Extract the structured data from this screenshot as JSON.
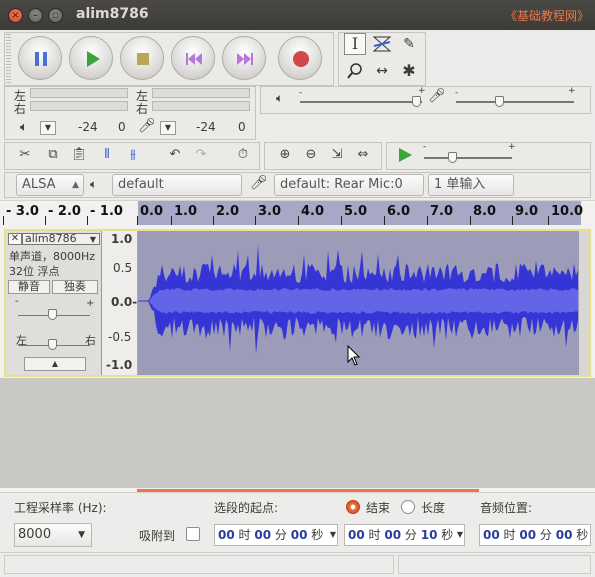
{
  "window": {
    "title": "alim8786",
    "watermark": "《基础教程网》"
  },
  "meters": {
    "left": "左",
    "right": "右",
    "play_db": "-24",
    "play_zero": "0",
    "rec_db": "-24",
    "rec_zero": "0"
  },
  "mixer": {
    "plus": "+",
    "minus": "-"
  },
  "device": {
    "host": "ALSA",
    "output": "default",
    "input": "default: Rear Mic:0",
    "channels": "1 单输入"
  },
  "ruler": {
    "ticks": [
      "- 3.0",
      "- 2.0",
      "- 1.0",
      "0.0",
      "1.0",
      "2.0",
      "3.0",
      "4.0",
      "5.0",
      "6.0",
      "7.0",
      "8.0",
      "9.0",
      "10.0"
    ]
  },
  "track": {
    "name": "alim8786",
    "info1": "单声道，8000Hz",
    "info2": "32位 浮点",
    "mute": "静音",
    "solo": "独奏",
    "gain_minus": "-",
    "gain_plus": "+",
    "pan_left": "左",
    "pan_right": "右",
    "scale": [
      "1.0",
      "0.5",
      "0.0-",
      "-0.5",
      "-1.0"
    ]
  },
  "selection": {
    "rate_label": "工程采样率 (Hz):",
    "rate_value": "8000",
    "snap_label": "吸附到",
    "start_label": "选段的起点:",
    "end_label": "结束",
    "length_label": "长度",
    "pos_label": "音频位置:",
    "start_time": {
      "h": "00",
      "hu": "时",
      "m": "00",
      "mu": "分",
      "s": "00",
      "su": "秒"
    },
    "end_time": {
      "h": "00",
      "hu": "时",
      "m": "00",
      "mu": "分",
      "s": "10",
      "su": "秒"
    },
    "pos_time": {
      "h": "00",
      "hu": "时",
      "m": "00",
      "mu": "分",
      "s": "00",
      "su": "秒"
    }
  },
  "colors": {
    "waveform": "#3535d6",
    "waveform_rms": "#6464e6",
    "accent": "#e9764a",
    "track_border": "#e6e08a"
  }
}
